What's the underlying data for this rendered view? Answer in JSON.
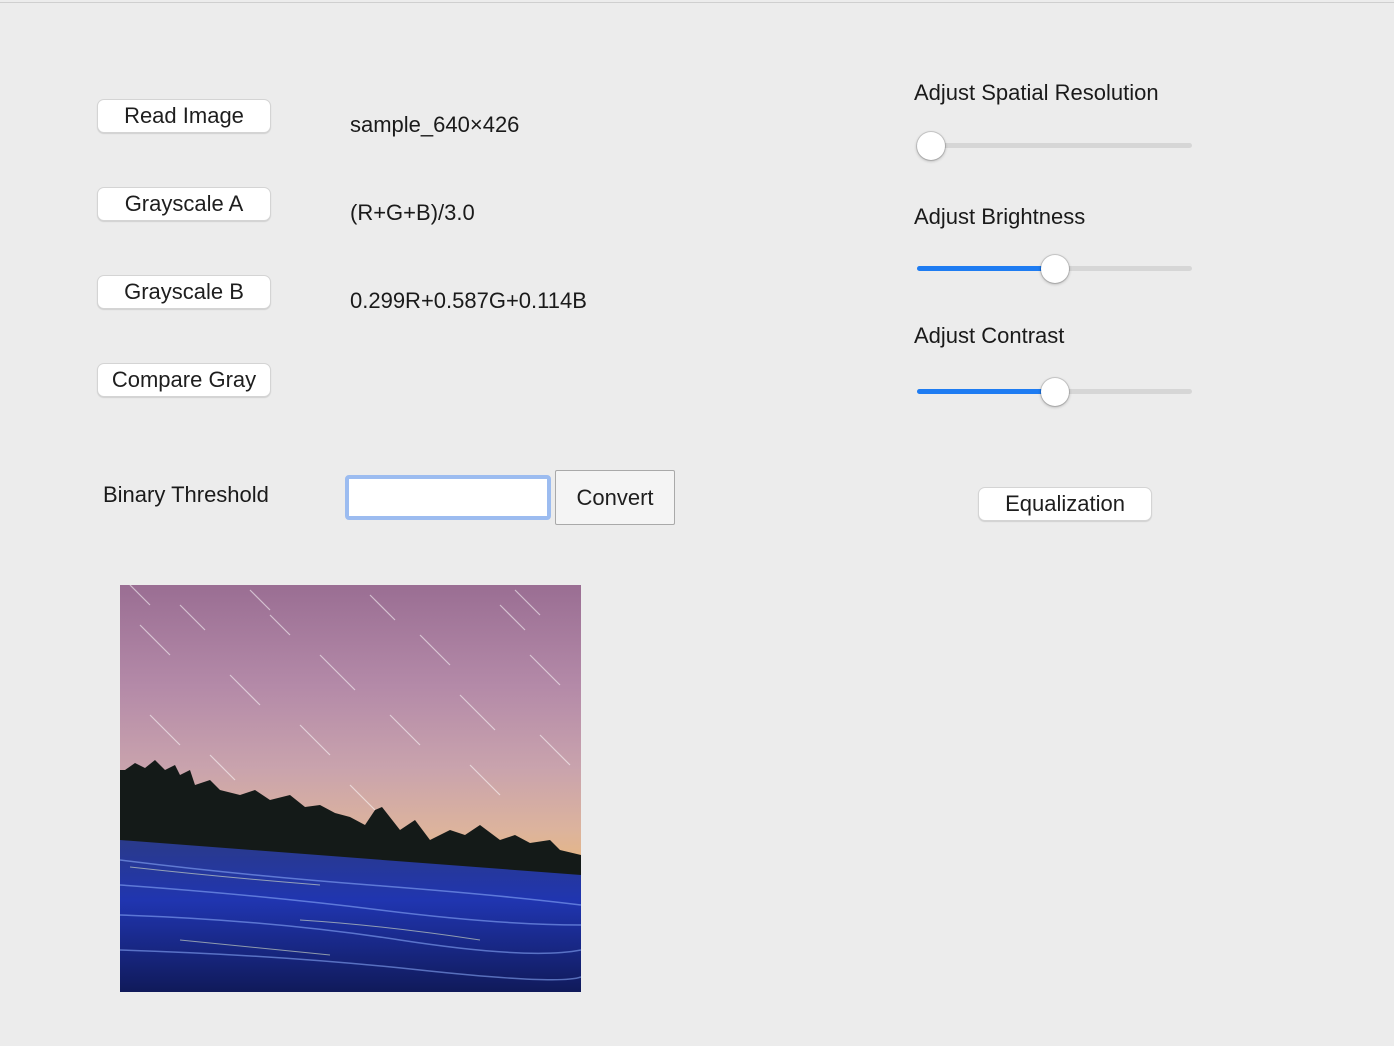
{
  "buttons": {
    "read_image": "Read Image",
    "grayscale_a": "Grayscale A",
    "grayscale_b": "Grayscale B",
    "compare_gray": "Compare Gray",
    "convert": "Convert",
    "equalization": "Equalization"
  },
  "info": {
    "filename": "sample_640×426",
    "formula_a": "(R+G+B)/3.0",
    "formula_b": "0.299R+0.587G+0.114B"
  },
  "threshold": {
    "label": "Binary Threshold",
    "value": ""
  },
  "sliders": [
    {
      "label": "Adjust Spatial Resolution",
      "value_fraction": 0.05
    },
    {
      "label": "Adjust Brightness",
      "value_fraction": 0.5
    },
    {
      "label": "Adjust Contrast",
      "value_fraction": 0.5
    }
  ],
  "colors": {
    "accent": "#1e7cf2",
    "window_bg": "#ececec",
    "focus_ring": "#9cbcf0"
  }
}
